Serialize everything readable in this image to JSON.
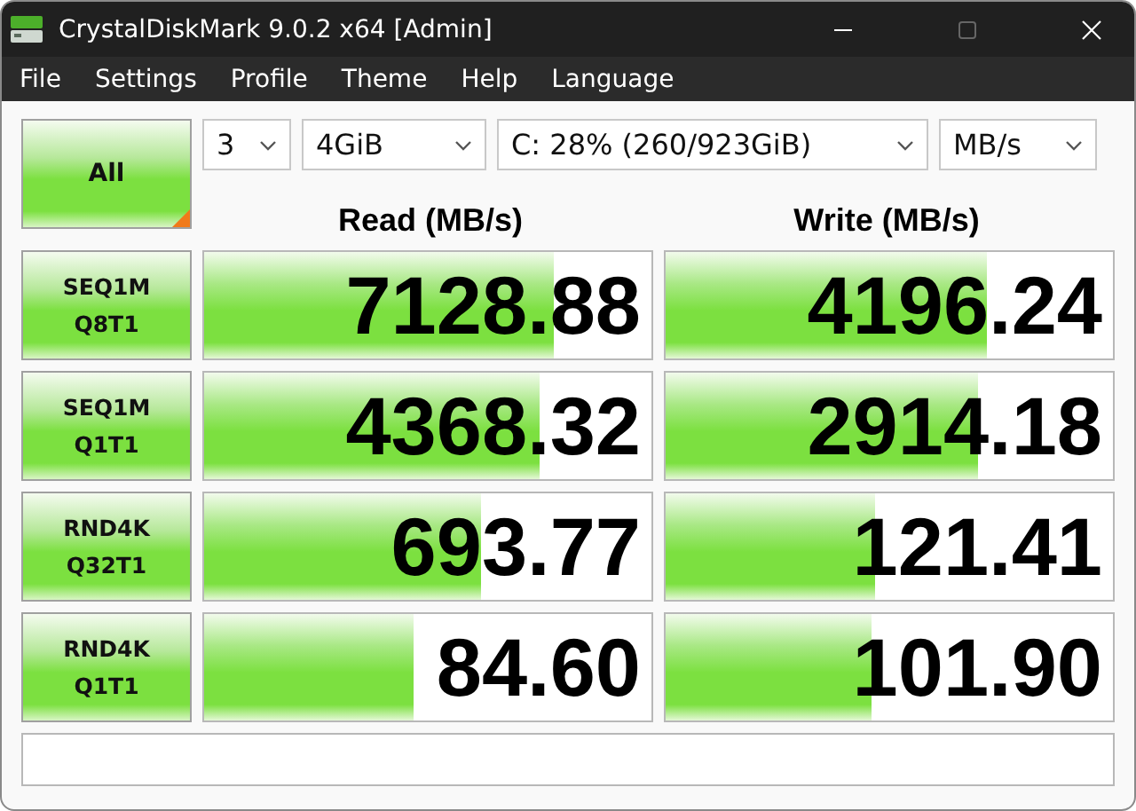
{
  "window": {
    "title": "CrystalDiskMark 9.0.2 x64 [Admin]",
    "maximize_disabled": true
  },
  "menu": [
    "File",
    "Settings",
    "Profile",
    "Theme",
    "Help",
    "Language"
  ],
  "all_button": "All",
  "selectors": [
    {
      "value": "3"
    },
    {
      "value": "4GiB"
    },
    {
      "value": "C: 28% (260/923GiB)"
    },
    {
      "value": "MB/s"
    }
  ],
  "headers": {
    "read": "Read (MB/s)",
    "write": "Write (MB/s)"
  },
  "tests": [
    {
      "label": [
        "SEQ1M",
        "Q8T1"
      ],
      "read": {
        "value": "7128.88",
        "level": 0.78
      },
      "write": {
        "value": "4196.24",
        "level": 0.72
      }
    },
    {
      "label": [
        "SEQ1M",
        "Q1T1"
      ],
      "read": {
        "value": "4368.32",
        "level": 0.75
      },
      "write": {
        "value": "2914.18",
        "level": 0.7
      }
    },
    {
      "label": [
        "RND4K",
        "Q32T1"
      ],
      "read": {
        "value": "693.77",
        "level": 0.62
      },
      "write": {
        "value": "121.41",
        "level": 0.47
      }
    },
    {
      "label": [
        "RND4K",
        "Q1T1"
      ],
      "read": {
        "value": "84.60",
        "level": 0.47
      },
      "write": {
        "value": "101.90",
        "level": 0.46
      }
    }
  ]
}
